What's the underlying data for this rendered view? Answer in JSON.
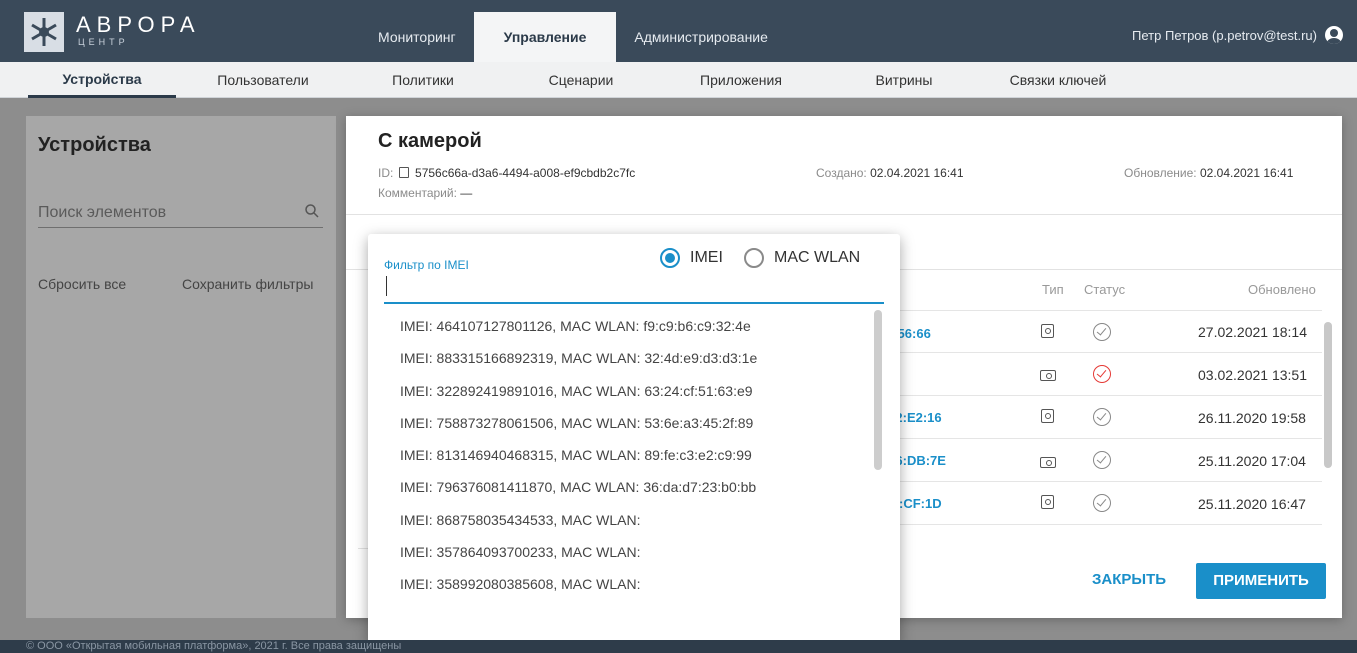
{
  "header": {
    "logo_title": "АВРОРА",
    "logo_subtitle": "ЦЕНТР",
    "nav": [
      "Мониторинг",
      "Управление",
      "Администрирование"
    ],
    "user": "Петр Петров (p.petrov@test.ru)"
  },
  "subnav": [
    "Устройства",
    "Пользователи",
    "Политики",
    "Сценарии",
    "Приложения",
    "Витрины",
    "Связки ключей"
  ],
  "left_panel": {
    "title": "Устройства",
    "search_placeholder": "Поиск элементов",
    "reset": "Сбросить все",
    "save_filters": "Сохранить фильтры"
  },
  "dialog": {
    "title": "С камерой",
    "id_label": "ID:",
    "id_value": "5756c66a-d3a6-4494-a008-ef9cbdb2c7fc",
    "comment_label": "Комментарий:",
    "comment_value": "—",
    "created_label": "Создано:",
    "created_value": "02.04.2021 16:41",
    "updated_label": "Обновление:",
    "updated_value": "02.04.2021 16:41",
    "columns": {
      "type": "Тип",
      "status": "Статус",
      "updated": "Обновлено"
    },
    "rows": [
      {
        "mac": "4:56:66",
        "type": "phone",
        "status": "ok",
        "date": "27.02.2021 18:14"
      },
      {
        "mac": "",
        "type": "tablet",
        "status": "error",
        "date": "03.02.2021 13:51"
      },
      {
        "mac": "A2:E2:16",
        "type": "phone",
        "status": "ok",
        "date": "26.11.2020 19:58"
      },
      {
        "mac": "D6:DB:7E",
        "type": "tablet",
        "status": "ok",
        "date": "25.11.2020 17:04"
      },
      {
        "mac": "IA:CF:1D",
        "type": "phone",
        "status": "ok",
        "date": "25.11.2020 16:47"
      }
    ],
    "close_button": "ЗАКРЫТЬ",
    "apply_button": "ПРИМЕНИТЬ"
  },
  "dropdown": {
    "filter_label": "Фильтр по IMEI",
    "radio_imei": "IMEI",
    "radio_mac": "MAC WLAN",
    "selected": "IMEI",
    "value": "",
    "options": [
      "IMEI: 464107127801126, MAC WLAN: f9:c9:b6:c9:32:4e",
      "IMEI: 883315166892319, MAC WLAN: 32:4d:e9:d3:d3:1e",
      "IMEI: 322892419891016, MAC WLAN: 63:24:cf:51:63:e9",
      "IMEI: 758873278061506, MAC WLAN: 53:6e:a3:45:2f:89",
      "IMEI: 813146940468315, MAC WLAN: 89:fe:c3:e2:c9:99",
      "IMEI: 796376081411870, MAC WLAN: 36:da:d7:23:b0:bb",
      "IMEI: 868758035434533, MAC WLAN:",
      "IMEI: 357864093700233, MAC WLAN:",
      "IMEI: 358992080385608, MAC WLAN:"
    ]
  },
  "footer": "© ООО «Открытая мобильная платформа», 2021 г. Все права защищены",
  "colors": {
    "accent": "#1a8fc9",
    "header": "#3a4a5a",
    "error": "#e53935"
  }
}
